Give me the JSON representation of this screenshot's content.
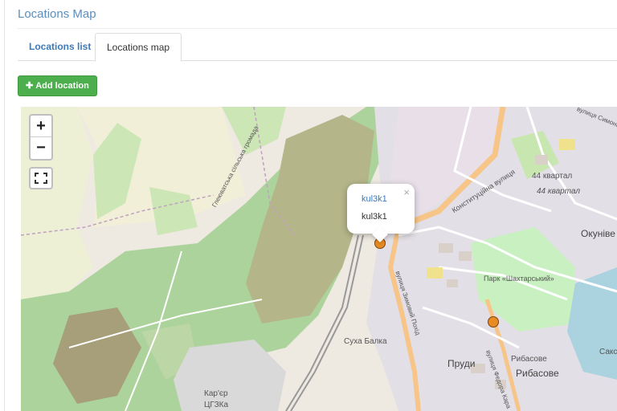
{
  "page": {
    "title": "Locations Map"
  },
  "tabs": [
    {
      "label": "Locations list",
      "active": false
    },
    {
      "label": "Locations map",
      "active": true
    }
  ],
  "toolbar": {
    "add_label": "Add location",
    "add_icon": "plus-icon",
    "add_color": "#4cae4c"
  },
  "map": {
    "zoom_in": "+",
    "zoom_out": "−",
    "fullscreen_icon": "fullscreen-icon",
    "popup": {
      "title_link": "kul3k1",
      "body_text": "kul3k1",
      "close": "×"
    },
    "markers": [
      {
        "name": "kul3k1"
      },
      {
        "name": ""
      }
    ],
    "marker_color": "#e98b22",
    "labels": {
      "kvartal_44_a": "44 квартал",
      "kvartal_44_b": "44 квартал",
      "okunive": "Окуніве",
      "park": "Парк «Шахтарський»",
      "sukha_balka": "Суха Балка",
      "prudy": "Пруди",
      "rybasove_a": "Рибасове",
      "rybasove_b": "Рибасове",
      "karier": "Кар'єр",
      "tsgzka": "ЦГЗКа",
      "konstytutsiina": "Конституційна вулиця",
      "zymovyi_pokhid": "вулиця Зимовий Похід",
      "fedora_kara": "вулиця Федора Кара",
      "hromada": "Глеюватська сільська громада",
      "simona": "вулиця Симона П",
      "saks": "Сакс"
    }
  }
}
